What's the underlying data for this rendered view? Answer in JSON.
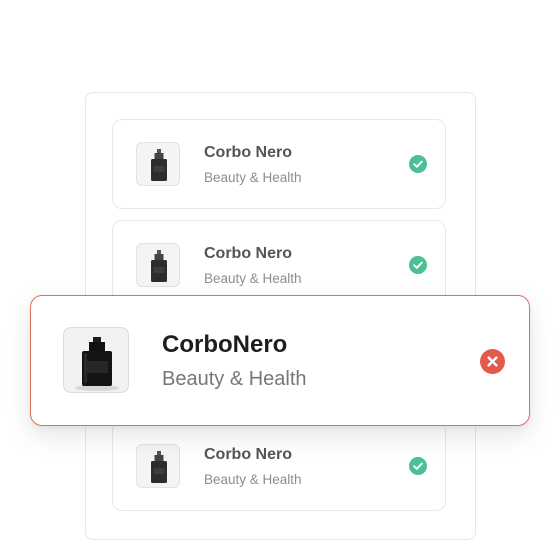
{
  "colors": {
    "success": "#4cbf94",
    "error": "#e25b4a",
    "highlight_border": "#e0705e"
  },
  "items": [
    {
      "name": "Corbo Nero",
      "category": "Beauty & Health",
      "status": "check-circle-icon"
    },
    {
      "name": "Corbo Nero",
      "category": "Beauty & Health",
      "status": "check-circle-icon"
    },
    {
      "name": "Corbo Nero",
      "category": "Beauty & Health",
      "status": "check-circle-icon"
    }
  ],
  "highlighted": {
    "name": "CorboNero",
    "category": "Beauty & Health",
    "status": "close-circle-icon"
  }
}
